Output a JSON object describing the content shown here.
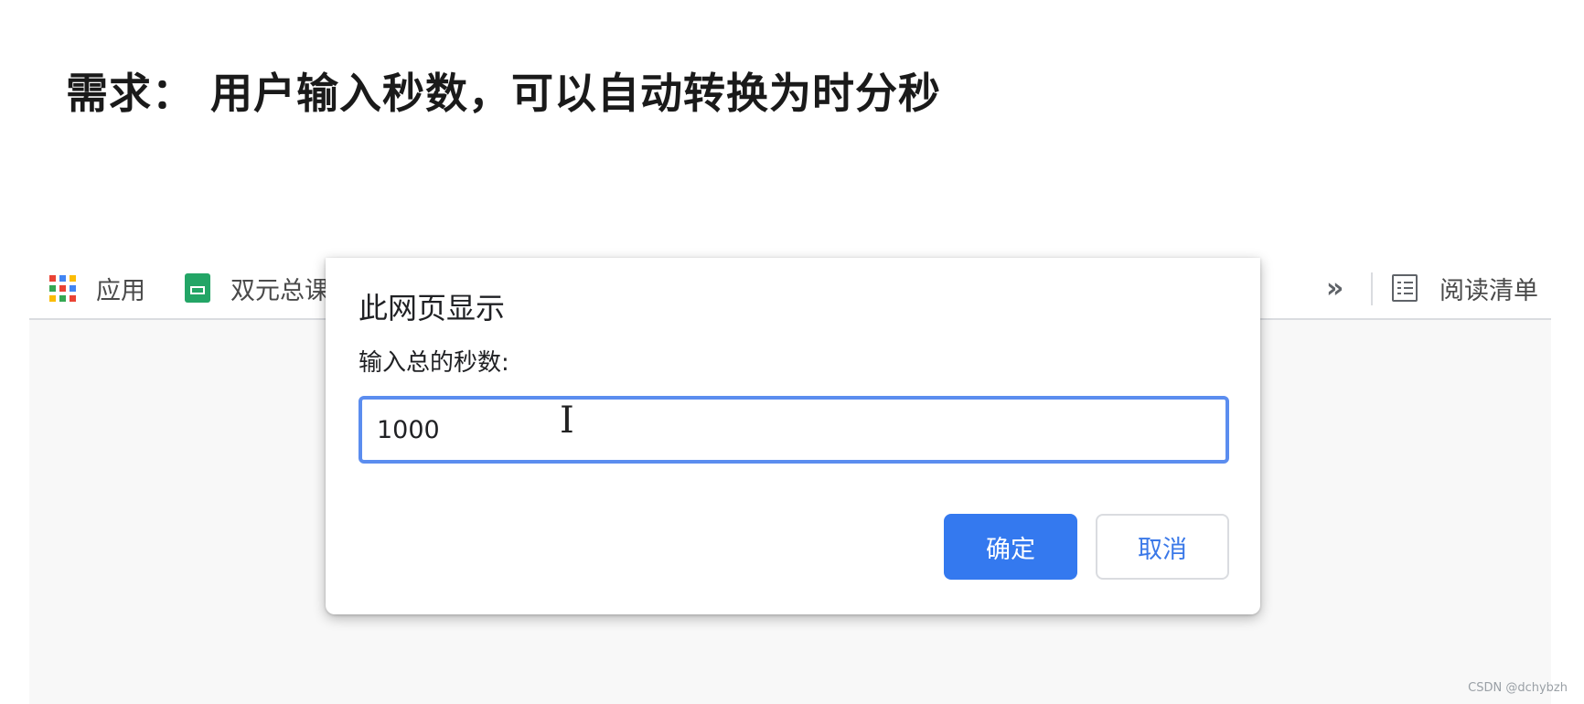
{
  "heading": "需求： 用户输入秒数，可以自动转换为时分秒",
  "bookmarks": {
    "apps_label": "应用",
    "apps_icon": "apps-grid-icon",
    "sheet_label": "双元总课",
    "sheet_icon": "google-sheets-icon",
    "more_icon": "double-chevron-right-icon",
    "reading_list_label": "阅读清单",
    "reading_list_icon": "reading-list-icon"
  },
  "dialog": {
    "title": "此网页显示",
    "message": "输入总的秒数:",
    "input_value": "1000",
    "ok_label": "确定",
    "cancel_label": "取消"
  },
  "watermark": "CSDN @dchybzh",
  "colors": {
    "primary_button": "#3479ef",
    "input_focus_border": "#5b8def",
    "cancel_text": "#3a78e8",
    "sheets_green": "#23a566"
  }
}
